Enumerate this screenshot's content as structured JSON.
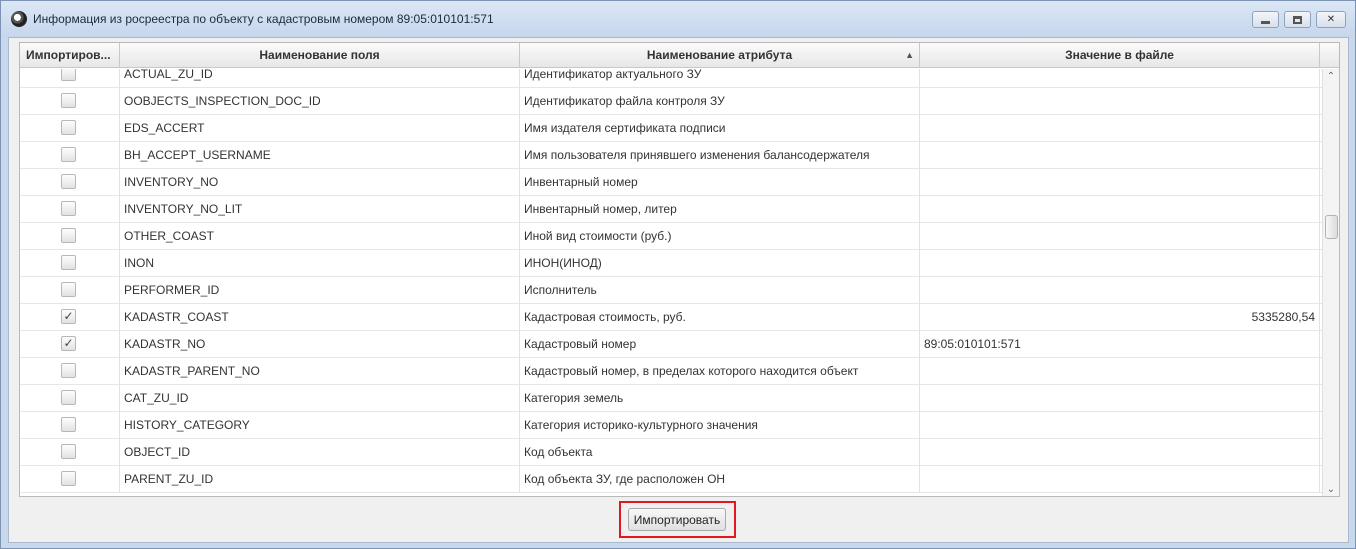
{
  "window": {
    "title": "Информация из росреестра по объекту с кадастровым номером 89:05:010101:571"
  },
  "table": {
    "columns": [
      "Импортиров...",
      "Наименование поля",
      "Наименование атрибута",
      "Значение в файле"
    ],
    "sorted_column": "Наименование атрибута",
    "rows": [
      {
        "checked": false,
        "field": "ACTUAL_ZU_ID",
        "attribute": "Идентификатор актуального ЗУ",
        "value": ""
      },
      {
        "checked": false,
        "field": "OOBJECTS_INSPECTION_DOC_ID",
        "attribute": "Идентификатор файла контроля ЗУ",
        "value": ""
      },
      {
        "checked": false,
        "field": "EDS_ACCERT",
        "attribute": "Имя издателя сертификата подписи",
        "value": ""
      },
      {
        "checked": false,
        "field": "BH_ACCEPT_USERNAME",
        "attribute": "Имя пользователя принявшего изменения балансодержателя",
        "value": ""
      },
      {
        "checked": false,
        "field": "INVENTORY_NO",
        "attribute": "Инвентарный номер",
        "value": ""
      },
      {
        "checked": false,
        "field": "INVENTORY_NO_LIT",
        "attribute": "Инвентарный номер, литер",
        "value": ""
      },
      {
        "checked": false,
        "field": "OTHER_COAST",
        "attribute": "Иной вид стоимости (руб.)",
        "value": ""
      },
      {
        "checked": false,
        "field": "INON",
        "attribute": "ИНОН(ИНОД)",
        "value": ""
      },
      {
        "checked": false,
        "field": "PERFORMER_ID",
        "attribute": "Исполнитель",
        "value": ""
      },
      {
        "checked": true,
        "field": "KADASTR_COAST",
        "attribute": "Кадастровая стоимость, руб.",
        "value": "5335280,54"
      },
      {
        "checked": true,
        "field": "KADASTR_NO",
        "attribute": "Кадастровый номер",
        "value": "89:05:010101:571"
      },
      {
        "checked": false,
        "field": "KADASTR_PARENT_NO",
        "attribute": "Кадастровый номер, в пределах которого находится объект",
        "value": ""
      },
      {
        "checked": false,
        "field": "CAT_ZU_ID",
        "attribute": "Категория земель",
        "value": ""
      },
      {
        "checked": false,
        "field": "HISTORY_CATEGORY",
        "attribute": "Категория  историко-культурного значения",
        "value": ""
      },
      {
        "checked": false,
        "field": "OBJECT_ID",
        "attribute": "Код объекта",
        "value": ""
      },
      {
        "checked": false,
        "field": "PARENT_ZU_ID",
        "attribute": "Код объекта ЗУ, где расположен ОН",
        "value": ""
      }
    ]
  },
  "actions": {
    "import_label": "Импортировать"
  },
  "icons": {
    "check": "✓",
    "sort_asc": "▲",
    "scroll_up": "⌃",
    "scroll_down": "⌄",
    "close": "✕"
  },
  "colors": {
    "highlight": "#e0181f",
    "titlebar": "#c6d6ec"
  }
}
